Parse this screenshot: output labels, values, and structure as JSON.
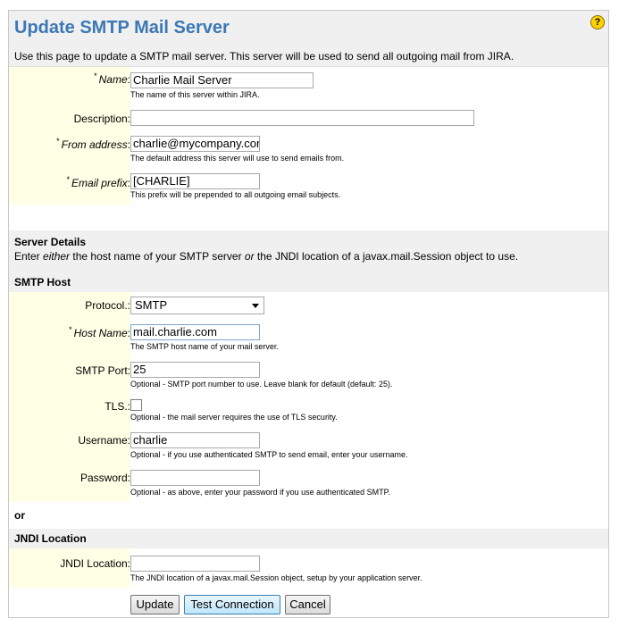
{
  "header": {
    "title": "Update SMTP Mail Server",
    "description": "Use this page to update a SMTP mail server. This server will be used to send all outgoing mail from JIRA.",
    "help_icon": "help-question-icon",
    "help_glyph": "?"
  },
  "form": {
    "required_marker": "*",
    "name": {
      "label": "Name",
      "value": "Charlie Mail Server",
      "hint": "The name of this server within JIRA."
    },
    "description": {
      "label": "Description:",
      "value": ""
    },
    "from_address": {
      "label": "From address",
      "value": "charlie@mycompany.com",
      "hint": "The default address this server will use to send emails from."
    },
    "email_prefix": {
      "label": "Email prefix",
      "value": "[CHARLIE]",
      "hint": "This prefix will be prepended to all outgoing email subjects."
    }
  },
  "server_details": {
    "title": "Server Details",
    "desc_pre": "Enter ",
    "desc_either": "either",
    "desc_mid": " the host name of your SMTP server ",
    "desc_or": "or",
    "desc_post": " the JNDI location of a javax.mail.Session object to use."
  },
  "smtp_host": {
    "title": "SMTP Host",
    "protocol": {
      "label": "Protocol.:",
      "value": "SMTP"
    },
    "host_name": {
      "label": "Host Name",
      "value": "mail.charlie.com",
      "hint": "The SMTP host name of your mail server."
    },
    "port": {
      "label": "SMTP Port:",
      "value": "25",
      "hint": "Optional - SMTP port number to use. Leave blank for default (default: 25)."
    },
    "tls": {
      "label": "TLS.:",
      "checked": false,
      "hint": "Optional - the mail server requires the use of TLS security."
    },
    "username": {
      "label": "Username:",
      "value": "charlie",
      "hint": "Optional - if you use authenticated SMTP to send email, enter your username."
    },
    "password": {
      "label": "Password:",
      "value": "",
      "hint": "Optional - as above, enter your password if you use authenticated SMTP."
    }
  },
  "or_label": "or",
  "jndi": {
    "title": "JNDI Location",
    "location": {
      "label": "JNDI Location:",
      "value": "",
      "hint": "The JNDI location of a javax.mail.Session object, setup by your application server."
    }
  },
  "buttons": {
    "update": "Update",
    "test": "Test Connection",
    "cancel": "Cancel"
  }
}
